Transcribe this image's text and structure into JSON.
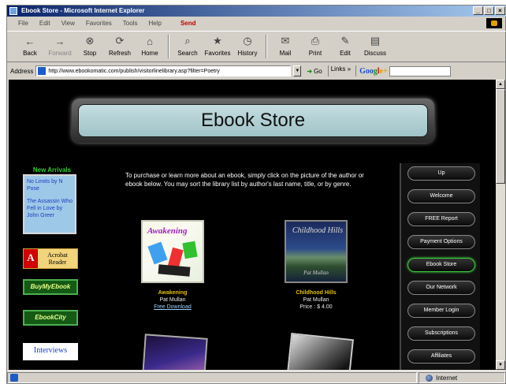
{
  "window": {
    "title": "Ebook Store - Microsoft Internet Explorer",
    "controls": {
      "minimize": "_",
      "maximize": "□",
      "close": "×"
    }
  },
  "menu": {
    "items": [
      "File",
      "Edit",
      "View",
      "Favorites",
      "Tools",
      "Help"
    ],
    "send": "Send"
  },
  "toolbar": {
    "buttons": [
      {
        "label": "Back",
        "icon": "back-arrow-icon"
      },
      {
        "label": "Forward",
        "icon": "forward-arrow-icon"
      },
      {
        "label": "Stop",
        "icon": "stop-icon"
      },
      {
        "label": "Refresh",
        "icon": "refresh-icon"
      },
      {
        "label": "Home",
        "icon": "home-icon"
      },
      {
        "label": "Search",
        "icon": "search-icon"
      },
      {
        "label": "Favorites",
        "icon": "favorites-icon"
      },
      {
        "label": "History",
        "icon": "history-icon"
      },
      {
        "label": "Mail",
        "icon": "mail-icon"
      },
      {
        "label": "Print",
        "icon": "print-icon"
      },
      {
        "label": "Edit",
        "icon": "edit-icon"
      },
      {
        "label": "Discuss",
        "icon": "discuss-icon"
      }
    ]
  },
  "address": {
    "label": "Address",
    "url": "http://www.ebookomatic.com/publish/visitorlinelibrary.asp?filter=Poetry",
    "go": "Go",
    "links": "Links »",
    "google": {
      "g": "Goo",
      "o": "g",
      "l": "l",
      "e": "e+"
    }
  },
  "page": {
    "banner_title": "Ebook Store",
    "new_arrivals": {
      "title": "New Arrivals",
      "items": [
        "No Limits by N Pose",
        "The Assassin Who Fell in Love by John Greer"
      ]
    },
    "logos": {
      "acrobat": {
        "brand": "A",
        "text": "Acrobat Reader"
      },
      "buy_my_ebook": "BuyMyEbook",
      "ebook_site": "EbookCity",
      "interviews": "Interviews"
    },
    "intro": "To purchase or learn more about an ebook, simply click on the picture of the author or ebook below. You may sort the library list by author's last name, title, or by genre.",
    "books": [
      {
        "title": "Awakening",
        "author": "Pat Mullan",
        "action": "Free Download",
        "cover_text": "Awakening"
      },
      {
        "title": "Childhood Hills",
        "author": "Pat Mullan",
        "action": "Price : $ 4.00",
        "cover_text": "Childhood Hills",
        "cover_author": "Pat Mullan"
      }
    ],
    "nav": [
      "Up",
      "Welcome",
      "FREE Report",
      "Payment Options",
      "Ebook Store",
      "Our Network",
      "Member Login",
      "Subscriptions",
      "Affiliates"
    ],
    "nav_active": "Ebook Store"
  },
  "status": {
    "zone": "Internet"
  },
  "colors": {
    "page_background": "#000000",
    "banner": "#b3d1d6",
    "new_arrivals_title": "#33cc33",
    "book_title": "#e0c000",
    "nav_active_border": "#3fcf3f"
  }
}
